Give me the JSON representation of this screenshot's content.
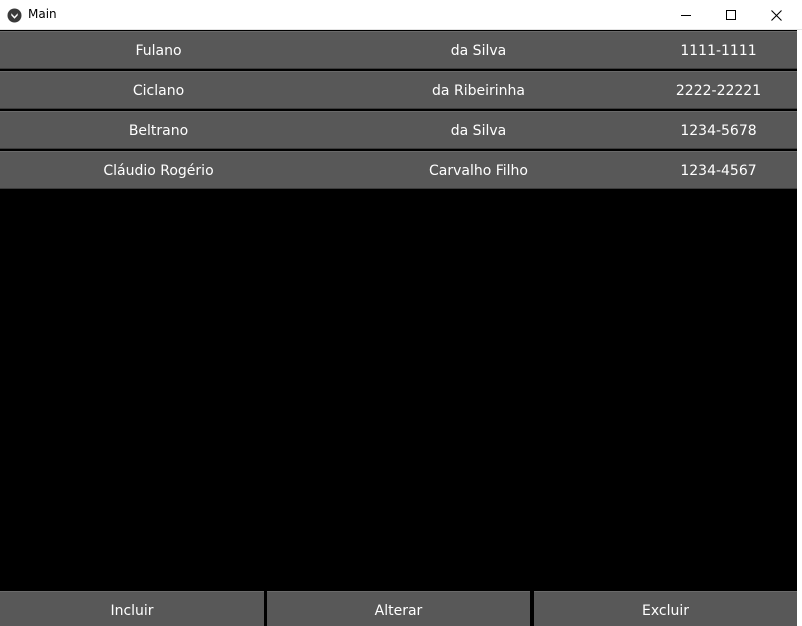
{
  "window": {
    "title": "Main",
    "icon": "kivy-logo-icon",
    "controls": {
      "minimize": "minimize-icon",
      "maximize": "maximize-icon",
      "close": "close-icon"
    }
  },
  "table": {
    "rows": [
      {
        "first_name": "Fulano",
        "last_name": "da Silva",
        "phone": "1111-1111"
      },
      {
        "first_name": "Ciclano",
        "last_name": "da Ribeirinha",
        "phone": "2222-22221"
      },
      {
        "first_name": "Beltrano",
        "last_name": "da Silva",
        "phone": "1234-5678"
      },
      {
        "first_name": "Cláudio Rogério",
        "last_name": "Carvalho Filho",
        "phone": "1234-4567"
      }
    ]
  },
  "actions": {
    "include_label": "Incluir",
    "edit_label": "Alterar",
    "delete_label": "Excluir"
  },
  "colors": {
    "background": "#000000",
    "row": "#585858",
    "text": "#ffffff"
  }
}
